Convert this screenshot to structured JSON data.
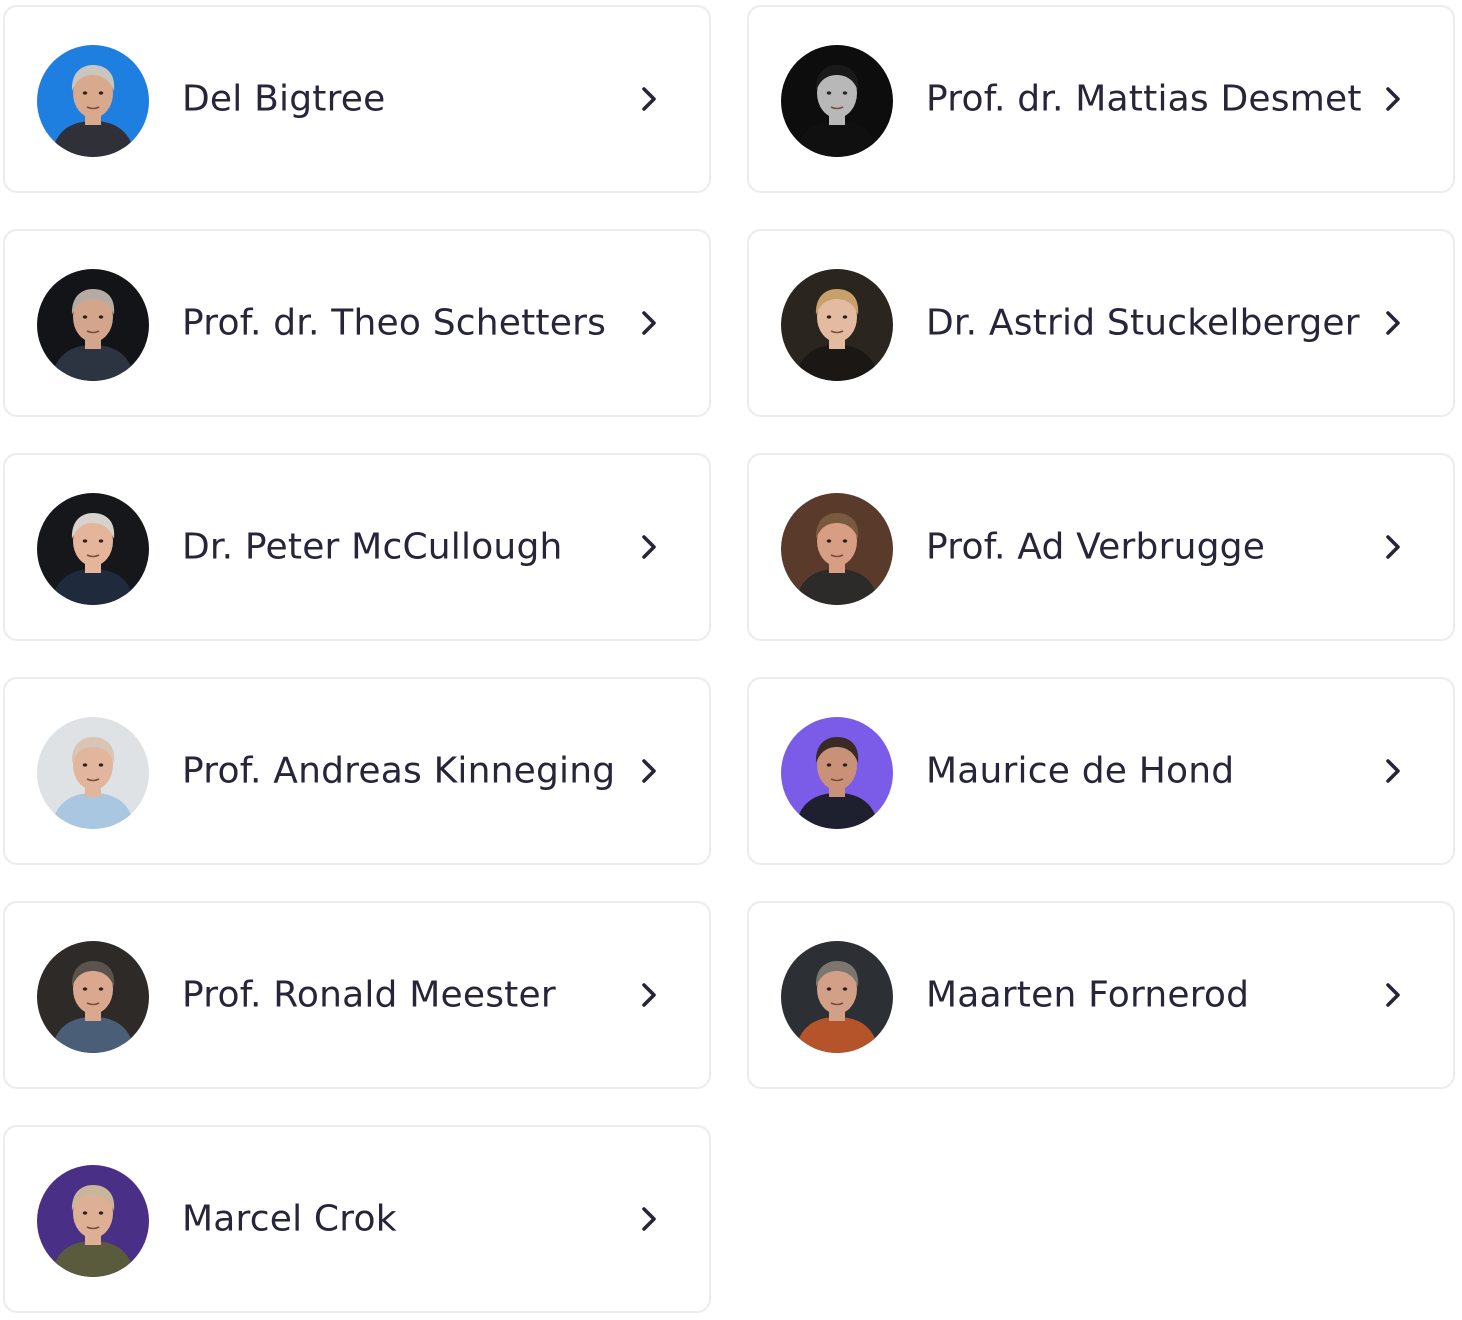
{
  "people": [
    {
      "name": "Del Bigtree",
      "avatar_bg": "#1e7fe0",
      "skin": "#d9a98e",
      "hair": "#c9c6c0",
      "clothes": "#2f3038"
    },
    {
      "name": "Prof. dr. Mattias Desmet",
      "avatar_bg": "#0d0d0d",
      "skin": "#b8b8b8",
      "hair": "#1a1a1a",
      "clothes": "#101010"
    },
    {
      "name": "Prof. dr. Theo Schetters",
      "avatar_bg": "#121417",
      "skin": "#d3a58d",
      "hair": "#b5aba2",
      "clothes": "#2c3442"
    },
    {
      "name": "Dr. Astrid Stuckelberger",
      "avatar_bg": "#2b2520",
      "skin": "#e3bba0",
      "hair": "#c9a06a",
      "clothes": "#1b1714"
    },
    {
      "name": "Dr. Peter McCullough",
      "avatar_bg": "#15171b",
      "skin": "#e4b49b",
      "hair": "#d7d3cc",
      "clothes": "#1f2a3d"
    },
    {
      "name": "Prof. Ad Verbrugge",
      "avatar_bg": "#5a3b2b",
      "skin": "#d79e84",
      "hair": "#7a5a3f",
      "clothes": "#2d2a2a"
    },
    {
      "name": "Prof. Andreas Kinneging",
      "avatar_bg": "#dfe2e4",
      "skin": "#e1b69c",
      "hair": "#d9c5b4",
      "clothes": "#a9c7e0"
    },
    {
      "name": "Maurice de Hond",
      "avatar_bg": "#7b5ce8",
      "skin": "#c99178",
      "hair": "#3a2a26",
      "clothes": "#1e2030"
    },
    {
      "name": "Prof. Ronald Meester",
      "avatar_bg": "#2d2a28",
      "skin": "#d9a88e",
      "hair": "#5c534c",
      "clothes": "#4a5e78"
    },
    {
      "name": "Maarten Fornerod",
      "avatar_bg": "#2c2f33",
      "skin": "#d2a087",
      "hair": "#7d766e",
      "clothes": "#b5542a"
    },
    {
      "name": "Marcel Crok",
      "avatar_bg": "#4a2f86",
      "skin": "#ddb096",
      "hair": "#c9b69a",
      "clothes": "#5a5a3c"
    }
  ],
  "colors": {
    "card_border": "#ebebf0",
    "name_text": "#27253a",
    "chevron": "#27253a"
  },
  "icons": {
    "chevron": "chevron-right-icon"
  }
}
